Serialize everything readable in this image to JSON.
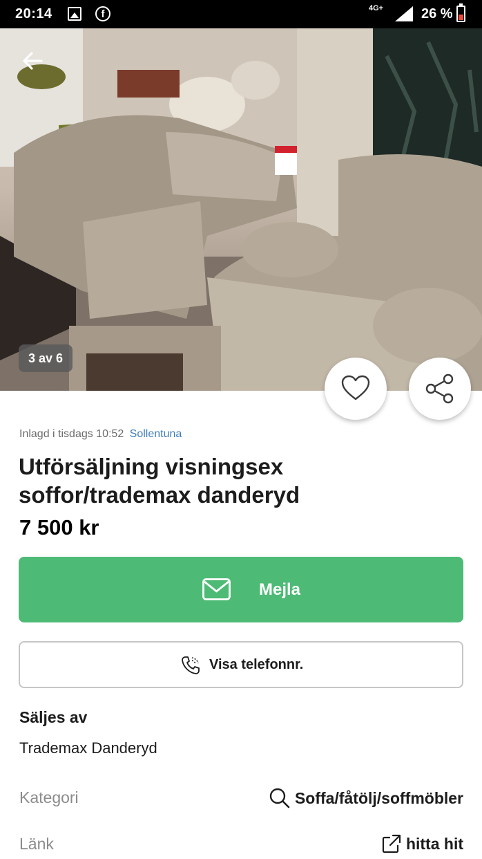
{
  "status_bar": {
    "time": "20:14",
    "network": "4G+",
    "battery_percent": "26 %",
    "icons": [
      "gallery-icon",
      "facebook-icon",
      "signal-icon",
      "battery-icon"
    ]
  },
  "gallery": {
    "counter": "3 av 6"
  },
  "listing": {
    "posted": "Inlagd i tisdags 10:52",
    "location": "Sollentuna",
    "title": "Utförsäljning visningsex soffor/trademax danderyd",
    "price": "7 500 kr"
  },
  "actions": {
    "mail_label": "Mejla",
    "phone_label": "Visa telefonnr.",
    "accent_color": "#4dbb75"
  },
  "seller": {
    "heading": "Säljes av",
    "name": "Trademax Danderyd"
  },
  "details": {
    "category_label": "Kategori",
    "category_value": "Soffa/fåtölj/soffmöbler",
    "link_label": "Länk",
    "link_value": "hitta hit"
  }
}
